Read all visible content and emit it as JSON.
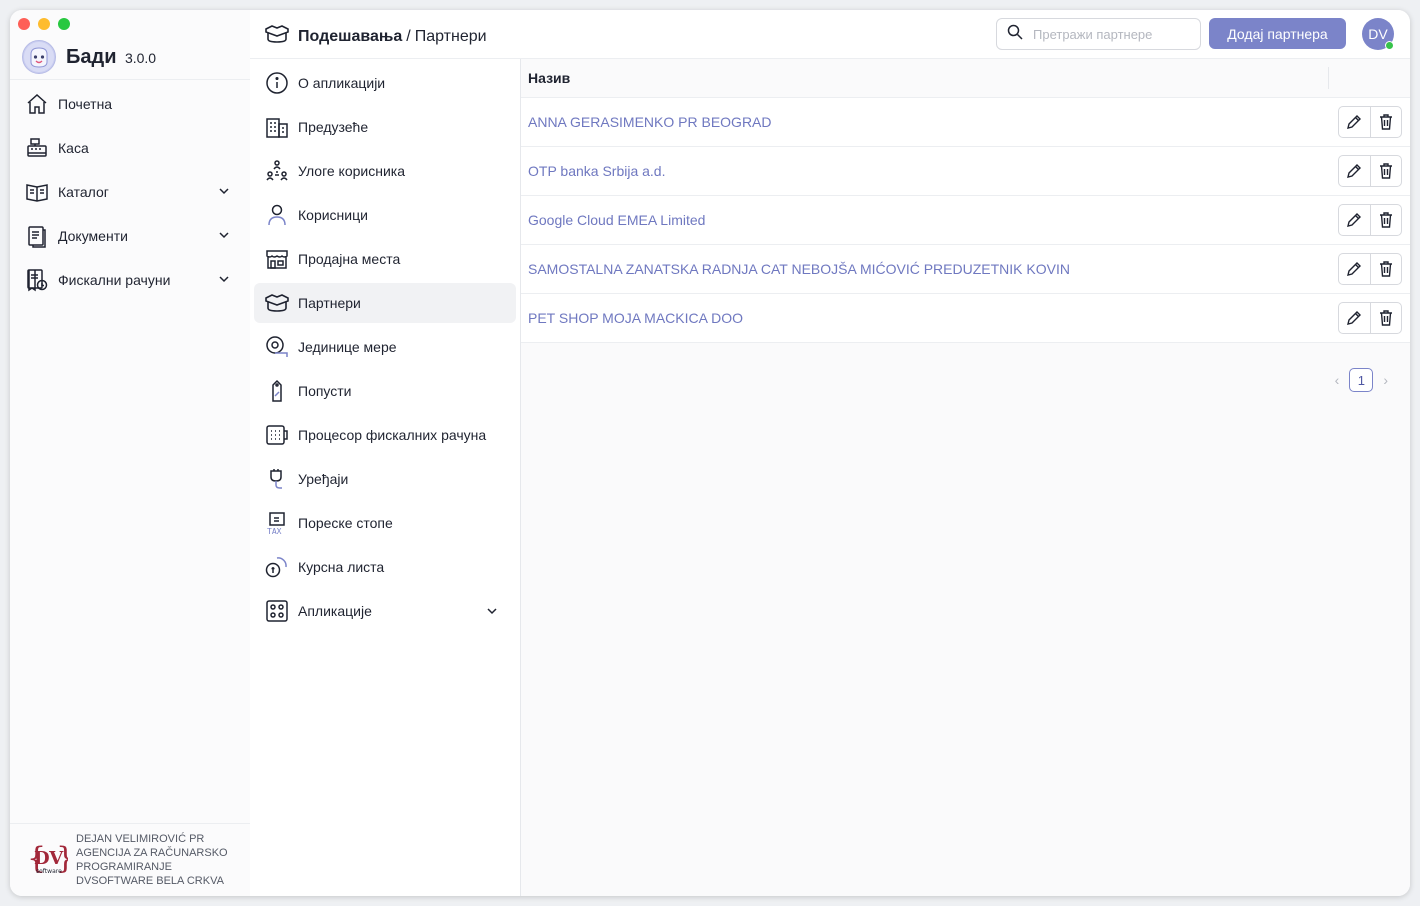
{
  "app": {
    "name": "Бади",
    "version": "3.0.0"
  },
  "sidebar": {
    "items": [
      {
        "label": "Почетна",
        "icon": "home-icon",
        "expandable": false
      },
      {
        "label": "Каса",
        "icon": "cash-register-icon",
        "expandable": false
      },
      {
        "label": "Каталог",
        "icon": "catalog-icon",
        "expandable": true
      },
      {
        "label": "Документи",
        "icon": "documents-icon",
        "expandable": true
      },
      {
        "label": "Фискални рачуни",
        "icon": "fiscal-receipt-icon",
        "expandable": true
      }
    ],
    "company": [
      "DEJAN VELIMIROVIĆ PR",
      "AGENCIJA ZA RAČUNARSKO",
      "PROGRAMIRANJE",
      "DVSOFTWARE BELA CRKVA"
    ],
    "company_logo_text": "DV",
    "company_logo_sub": "software"
  },
  "header": {
    "section": "Подешавања",
    "separator": "/",
    "page": "Партнери",
    "search_placeholder": "Претражи партнере",
    "add_button": "Додај партнера",
    "avatar_initials": "DV"
  },
  "settings_menu": {
    "active": "Партнери",
    "items": [
      {
        "label": "О апликацији",
        "icon": "info-icon"
      },
      {
        "label": "Предузеће",
        "icon": "building-icon"
      },
      {
        "label": "Улоге корисника",
        "icon": "user-roles-icon"
      },
      {
        "label": "Корисници",
        "icon": "user-icon"
      },
      {
        "label": "Продајна места",
        "icon": "store-icon"
      },
      {
        "label": "Партнери",
        "icon": "handshake-icon"
      },
      {
        "label": "Јединице мере",
        "icon": "measure-tape-icon"
      },
      {
        "label": "Попусти",
        "icon": "discount-tag-icon"
      },
      {
        "label": "Процесор фискалних рачуна",
        "icon": "fiscal-processor-icon"
      },
      {
        "label": "Уређаји",
        "icon": "device-icon"
      },
      {
        "label": "Пореске стопе",
        "icon": "tax-icon"
      },
      {
        "label": "Курсна листа",
        "icon": "exchange-rate-icon"
      },
      {
        "label": "Апликације",
        "icon": "apps-icon",
        "expandable": true
      }
    ]
  },
  "table": {
    "column_name": "Назив",
    "rows": [
      "ANNA GERASIMENKO PR BEOGRAD",
      "OTP banka Srbija a.d.",
      "Google Cloud EMEA Limited",
      "SAMOSTALNA ZANATSKA RADNJA CAT NEBOJŠA MIĆOVIĆ PREDUZETNIK KOVIN",
      "PET SHOP MOJA MACKICA DOO"
    ]
  },
  "pagination": {
    "current_page": "1"
  },
  "colors": {
    "accent": "#7b84c9",
    "link": "#6f78c0",
    "active_bg": "#f1f2f4",
    "online": "#37c24a"
  }
}
